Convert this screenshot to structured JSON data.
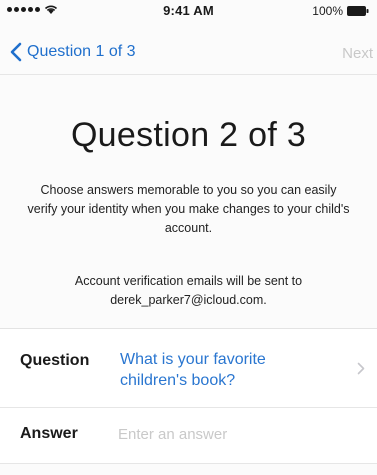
{
  "status_bar": {
    "time": "9:41 AM",
    "battery_percent": "100%",
    "icons": [
      "signal-dots-icon",
      "wifi-icon",
      "battery-icon"
    ]
  },
  "nav": {
    "back_label": "Question 1 of 3",
    "next_label": "Next",
    "icons": [
      "chevron-left-icon"
    ]
  },
  "main": {
    "title": "Question 2 of 3",
    "instructions": "Choose answers memorable to you so you can easily verify your identity when you make changes to your child's account.",
    "verify_note_line1": "Account verification emails will be sent to",
    "verify_note_line2": "derek_parker7@icloud.com."
  },
  "form": {
    "question_label": "Question",
    "question_value": "What is your favorite children's book?",
    "answer_label": "Answer",
    "answer_placeholder": "Enter an answer",
    "answer_value": ""
  },
  "colors": {
    "accent": "#1f6fcc",
    "link_text": "#2a76d0",
    "disabled": "#c8c8c8",
    "placeholder": "#c9c9c9"
  }
}
